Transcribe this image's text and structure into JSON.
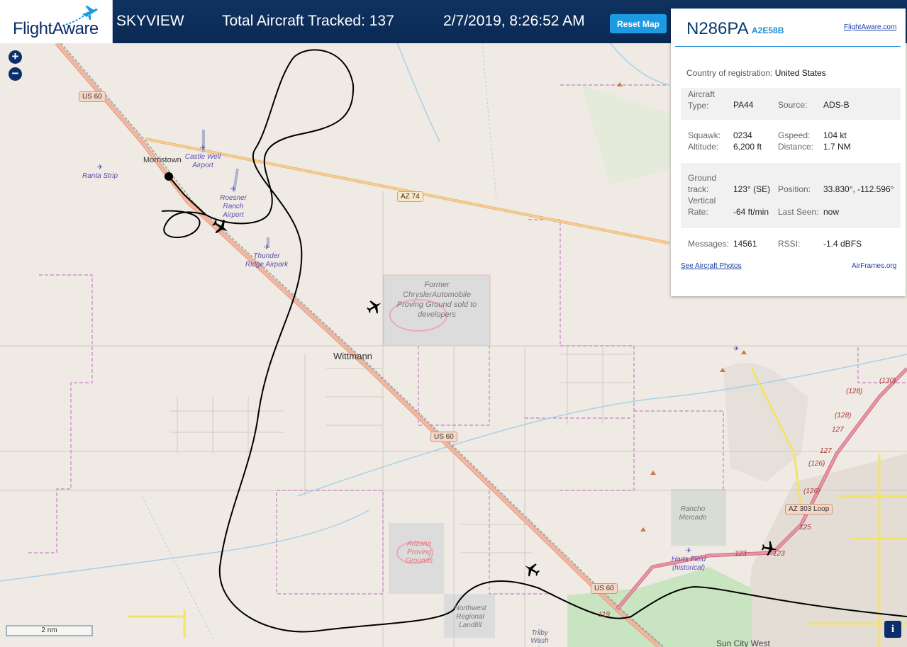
{
  "header": {
    "logo_text": "FlightAware",
    "app_name": "SKYVIEW",
    "aircraft_tracked_label": "Total Aircraft Tracked: 137",
    "datetime": "2/7/2019, 8:26:52 AM",
    "reset_button": "Reset Map",
    "colors": {
      "background": "#0a2a54",
      "button": "#1c9ae2"
    }
  },
  "map_controls": {
    "zoom_in": "+",
    "zoom_out": "−",
    "scale": "2 nm",
    "info": "i"
  },
  "map_labels": {
    "places": [
      {
        "name": "Morristown",
        "type": "town"
      },
      {
        "name": "Wittmann",
        "type": "town"
      }
    ],
    "airports": [
      {
        "name": "Castle Well Airport"
      },
      {
        "name": "Ranta Strip"
      },
      {
        "name": "Roesner Ranch Airport"
      },
      {
        "name": "Thunder Ridge Airpark"
      },
      {
        "name": "Harts Field (historical)"
      }
    ],
    "areas": [
      {
        "name": "Former ChryslerAutomobile Proving Ground sold to developers"
      },
      {
        "name": "Arizona Proving Grounds"
      },
      {
        "name": "Rancho Mercado"
      },
      {
        "name": "Northwest Regional Landfill"
      },
      {
        "name": "Trilby Wash"
      },
      {
        "name": "Sun City West"
      }
    ],
    "roads": [
      {
        "name": "US 60",
        "type": "us"
      },
      {
        "name": "AZ 74",
        "type": "state"
      },
      {
        "name": "AZ 303 Loop",
        "type": "us"
      }
    ],
    "loop_numbers": [
      "(130)",
      "(128)",
      "(128)",
      "127",
      "127",
      "(126)",
      "(126)",
      "125",
      "123",
      "123",
      "119"
    ]
  },
  "selected_aircraft": {
    "registration": "N286PA",
    "hex": "A2E58B",
    "flightaware_link": "FlightAware.com",
    "country_label": "Country of registration:",
    "country": "United States",
    "aircraft_type_label": "Aircraft Type:",
    "aircraft_type": "PA44",
    "source_label": "Source:",
    "source": "ADS-B",
    "squawk_label": "Squawk:",
    "squawk": "0234",
    "gspeed_label": "Gspeed:",
    "gspeed": "104 kt",
    "altitude_label": "Altitude:",
    "altitude": "6,200 ft",
    "distance_label": "Distance:",
    "distance": "1.7 NM",
    "ground_track_label": "Ground track:",
    "ground_track": "123° (SE)",
    "position_label": "Position:",
    "position": "33.830°, -112.596°",
    "vertical_rate_label": "Vertical Rate:",
    "vertical_rate": "-64 ft/min",
    "last_seen_label": "Last Seen:",
    "last_seen": "now",
    "messages_label": "Messages:",
    "messages": "14561",
    "rssi_label": "RSSI:",
    "rssi": "-1.4 dBFS",
    "photos_link": "See Aircraft Photos",
    "airframes_link": "AirFrames.org"
  },
  "icons": {
    "aircraft": "airplane-icon",
    "airport": "airport-icon",
    "peak": "peak-icon"
  }
}
